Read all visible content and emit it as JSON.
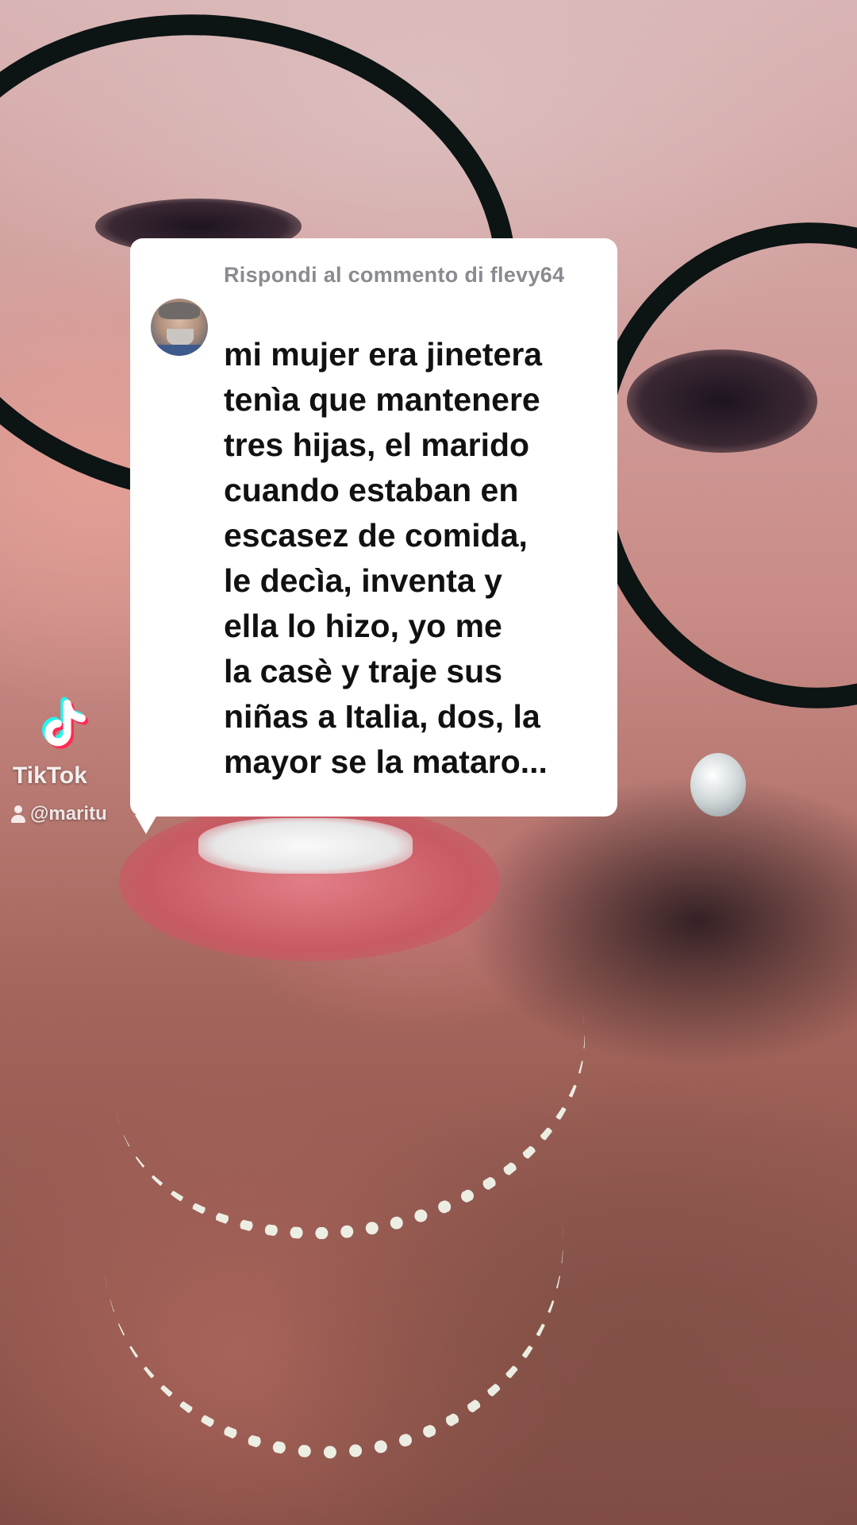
{
  "reply": {
    "header": "Rispondi al commento di flevy64",
    "body": "mi mujer era jinetera\ntenìa que mantenere\ntres hijas, el marido\ncuando estaban en\nescasez de comida,\nle decìa, inventa y\nella lo hizo, yo me\nla casè y traje sus\nniñas a Italia, dos, la\nmayor se la mataro..."
  },
  "watermark": {
    "brand": "TikTok",
    "username": "@maritu"
  },
  "colors": {
    "card_background": "#ffffff",
    "header_text": "#8a8b91",
    "body_text": "#111111",
    "tiktok_cyan": "#25f4ee",
    "tiktok_pink": "#fe2c55"
  },
  "icons": {
    "tiktok_logo": "tiktok-logo-icon",
    "user": "user-icon"
  }
}
